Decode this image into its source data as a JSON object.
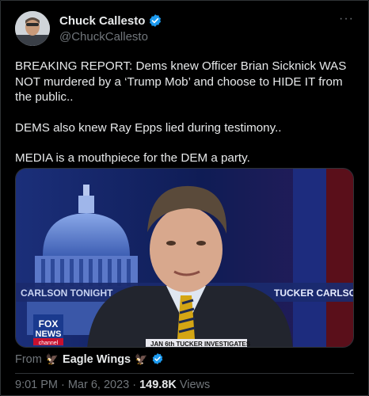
{
  "author": {
    "display_name": "Chuck Callesto",
    "handle": "@ChuckCallesto",
    "verified_color": "#1d9bf0"
  },
  "menu": {
    "more_icon": "···"
  },
  "tweet": {
    "paragraphs": [
      "BREAKING REPORT: Dems knew Officer Brian Sicknick WAS NOT murdered by a ‘Trump Mob’ and choose to HIDE IT from the public..",
      "DEMS also knew Ray Epps lied during testimony..",
      "MEDIA is a mouthpiece for the DEM a party."
    ]
  },
  "media": {
    "lower_third_left": "CARLSON TONIGHT",
    "lower_third_right": "TUCKER CARLSO",
    "network_logo_top": "FOX",
    "network_logo_mid": "NEWS",
    "network_logo_bottom": "channel",
    "ticker": "JAN 6th TUCKER INVESTIGATES"
  },
  "attribution": {
    "from_label": "From",
    "source_name": "Eagle Wings",
    "eagle_icon": "🦅"
  },
  "meta": {
    "time": "9:01 PM",
    "separator": "·",
    "date": "Mar 6, 2023",
    "views_count": "149.8K",
    "views_label": "Views"
  }
}
